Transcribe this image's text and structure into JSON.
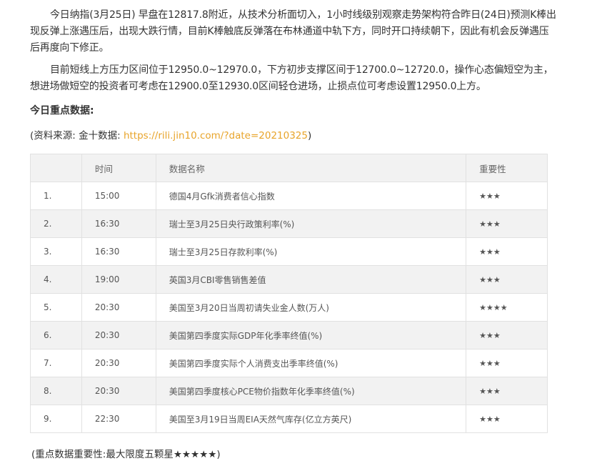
{
  "article": {
    "para1": "今日纳指(3月25日) 早盘在12817.8附近，从技术分析面切入，1小时线级别观察走势架构符合昨日(24日)预测K棒出现反弹上涨遇压后，出现大跌行情，目前K棒触底反弹落在布林通道中轨下方，同时开口持续朝下，因此有机会反弹遇压后再度向下修正。",
    "para2": "目前短线上方压力区间位于12950.0~12970.0，下方初步支撑区间于12700.0~12720.0，操作心态偏短空为主，想进场做短空的投资者可考虑在12900.0至12930.0区间轻仓进场，止损点位可考虑设置12950.0上方。",
    "heading": "今日重点数据:",
    "source_prefix": "(资料来源: 金十数据: ",
    "source_link": "https://rili.jin10.com/?date=20210325",
    "source_suffix": ")",
    "note": "(重点数据重要性:最大限度五颗星★★★★★)"
  },
  "table": {
    "headers": [
      "",
      "时间",
      "数据名称",
      "重要性"
    ],
    "rows": [
      [
        "1.",
        "15:00",
        "德国4月Gfk消费者信心指数",
        "★★★"
      ],
      [
        "2.",
        "16:30",
        "瑞士至3月25日央行政策利率(%)",
        "★★★"
      ],
      [
        "3.",
        "16:30",
        "瑞士至3月25日存款利率(%)",
        "★★★"
      ],
      [
        "4.",
        "19:00",
        "英国3月CBI零售销售差值",
        "★★★"
      ],
      [
        "5.",
        "20:30",
        "美国至3月20日当周初请失业金人数(万人)",
        "★★★★"
      ],
      [
        "6.",
        "20:30",
        "美国第四季度实际GDP年化季率终值(%)",
        "★★★"
      ],
      [
        "7.",
        "20:30",
        "美国第四季度实际个人消费支出季率终值(%)",
        "★★★"
      ],
      [
        "8.",
        "20:30",
        "美国第四季度核心PCE物价指数年化季率终值(%)",
        "★★★"
      ],
      [
        "9.",
        "22:30",
        "美国至3月19日当周EIA天然气库存(亿立方英尺)",
        "★★★"
      ]
    ]
  },
  "colors": {
    "link": "#e8a42a",
    "row_alt": "#f2f2f2",
    "border": "#e1e1e1"
  }
}
